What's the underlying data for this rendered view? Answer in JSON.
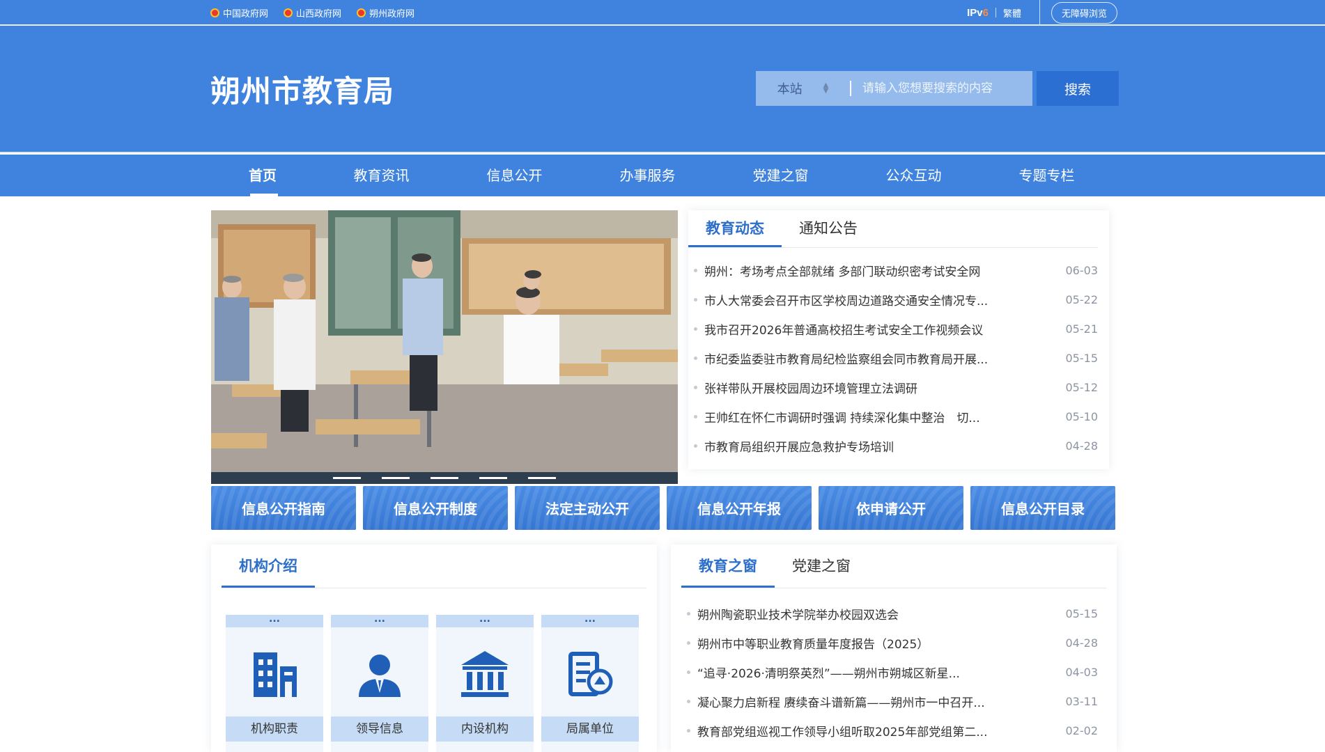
{
  "topbar": {
    "links": [
      "中国政府网",
      "山西政府网",
      "朔州政府网"
    ],
    "ipv6_prefix": "IPv",
    "ipv6_suffix": "6",
    "traditional": "繁體",
    "accessible": "无障碍浏览"
  },
  "header": {
    "title": "朔州市教育局",
    "search_scope": "本站",
    "search_placeholder": "请输入您想要搜索的内容",
    "search_button": "搜索"
  },
  "nav": {
    "items": [
      "首页",
      "教育资讯",
      "信息公开",
      "办事服务",
      "党建之窗",
      "公众互动",
      "专题专栏"
    ],
    "active_index": 0
  },
  "news": {
    "tabs": [
      "教育动态",
      "通知公告"
    ],
    "active_tab": 0,
    "items": [
      {
        "title": "朔州：考场考点全部就绪 多部门联动织密考试安全网",
        "date": "06-03"
      },
      {
        "title": "市人大常委会召开市区学校周边道路交通安全情况专...",
        "date": "05-22"
      },
      {
        "title": "我市召开2026年普通高校招生考试安全工作视频会议",
        "date": "05-21"
      },
      {
        "title": "市纪委监委驻市教育局纪检监察组会同市教育局开展...",
        "date": "05-15"
      },
      {
        "title": "张祥带队开展校园周边环境管理立法调研",
        "date": "05-12"
      },
      {
        "title": "王帅红在怀仁市调研时强调 持续深化集中整治　切...",
        "date": "05-10"
      },
      {
        "title": "市教育局组织开展应急救护专场培训",
        "date": "04-28"
      }
    ]
  },
  "info_buttons": [
    "信息公开指南",
    "信息公开制度",
    "法定主动公开",
    "信息公开年报",
    "依申请公开",
    "信息公开目录"
  ],
  "org": {
    "tab": "机构介绍",
    "cards": [
      {
        "label": "机构职责",
        "icon": "building-icon",
        "more": "..."
      },
      {
        "label": "领导信息",
        "icon": "person-icon",
        "more": "..."
      },
      {
        "label": "内设机构",
        "icon": "institution-icon",
        "more": "..."
      },
      {
        "label": "局属单位",
        "icon": "document-badge-icon",
        "more": "..."
      }
    ]
  },
  "window": {
    "tabs": [
      "教育之窗",
      "党建之窗"
    ],
    "active_tab": 0,
    "items": [
      {
        "title": "朔州陶瓷职业技术学院举办校园双选会",
        "date": "05-15"
      },
      {
        "title": "朔州市中等职业教育质量年度报告（2025）",
        "date": "04-28"
      },
      {
        "title": "“追寻·2026·清明祭英烈”——朔州市朔城区新星...",
        "date": "04-03"
      },
      {
        "title": "凝心聚力启新程 赓续奋斗谱新篇——朔州市一中召开...",
        "date": "03-11"
      },
      {
        "title": "教育部党组巡视工作领导小组听取2025年部党组第二...",
        "date": "02-02"
      }
    ]
  },
  "colors": {
    "primary": "#3f83df",
    "accent": "#2d6fc9",
    "date": "#8c95a3"
  }
}
